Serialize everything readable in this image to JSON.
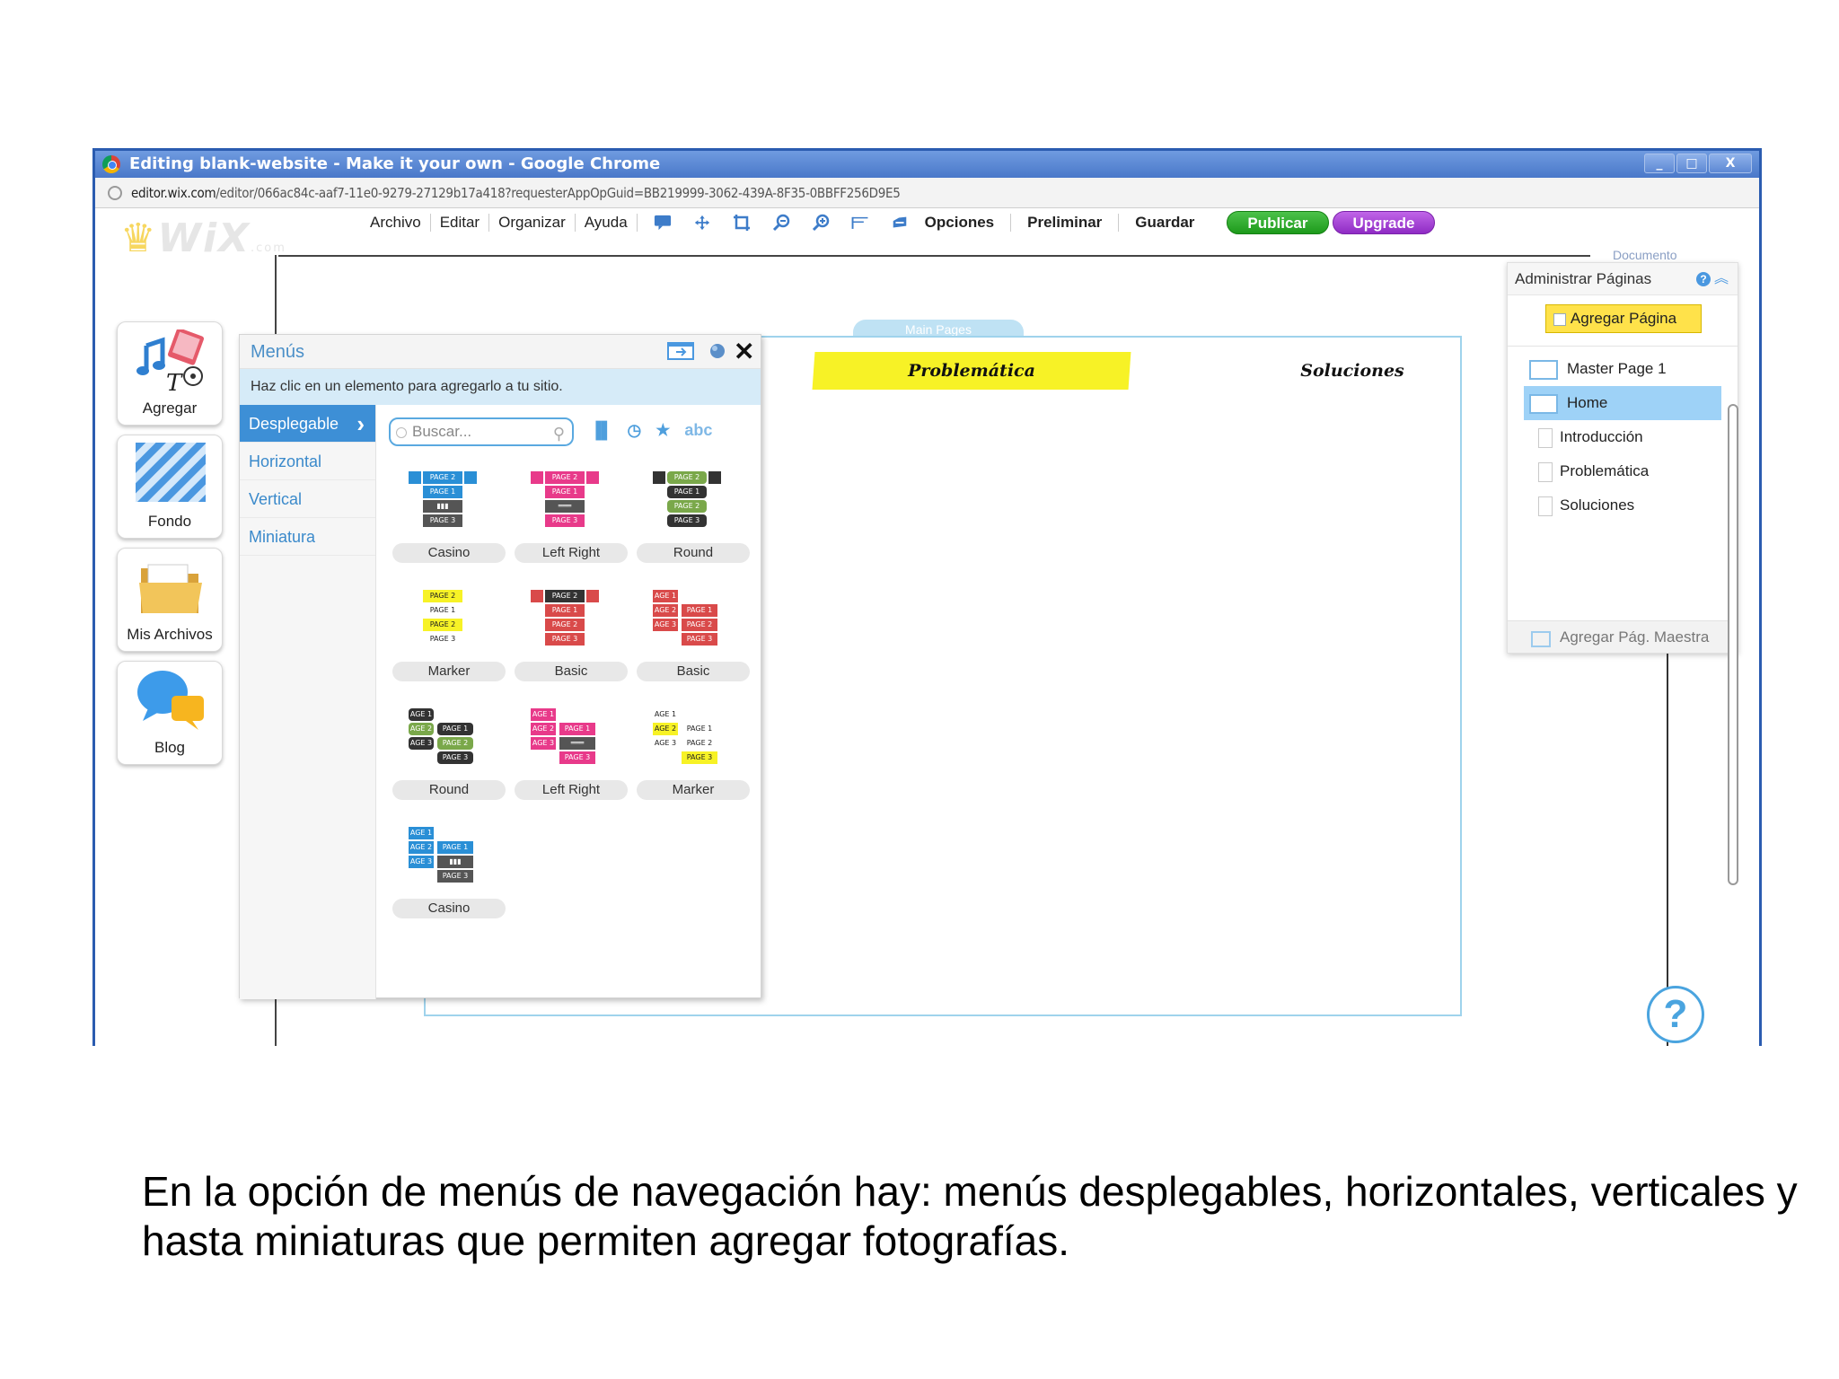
{
  "window": {
    "title": "Editing blank-website - Make it your own - Google Chrome",
    "controls": [
      "_",
      "□",
      "X"
    ],
    "url_host": "editor.wix.com",
    "url_path": "/editor/066ac84c-aaf7-11e0-9279-27129b17a418?requesterAppOpGuid=BB219999-3062-439A-8F35-0BBFF256D9E5"
  },
  "editor": {
    "logo": "WiX",
    "logo_suffix": ".com",
    "menu": [
      "Archivo",
      "Editar",
      "Organizar",
      "Ayuda"
    ],
    "tools": [
      "comment-icon",
      "move-icon",
      "crop-icon",
      "zoom-out-icon",
      "zoom-in-icon",
      "flag-icon",
      "cloud-icon"
    ],
    "opciones": "Opciones",
    "preliminar": "Preliminar",
    "guardar": "Guardar",
    "publicar": "Publicar",
    "upgrade": "Upgrade",
    "colors": {
      "publish": "#1d9a1b",
      "upgrade": "#8f2bc4",
      "accent": "#3d8fd6",
      "nav_highlight": "#f7f226"
    }
  },
  "sidebar": {
    "items": [
      {
        "label": "Agregar",
        "icon": "add-media-icon"
      },
      {
        "label": "Fondo",
        "icon": "background-icon"
      },
      {
        "label": "Mis Archivos",
        "icon": "folder-icon"
      },
      {
        "label": "Blog",
        "icon": "blog-bubble-icon"
      }
    ]
  },
  "stage": {
    "tab": "Main Pages",
    "nav": [
      "Problemática",
      "Soluciones"
    ]
  },
  "menus_panel": {
    "title": "Menús",
    "hint": "Haz clic en un elemento para agregarlo a tu sitio.",
    "categories": [
      "Desplegable",
      "Horizontal",
      "Vertical",
      "Miniatura"
    ],
    "active_category": "Desplegable",
    "search_placeholder": "Buscar...",
    "filter_text": "abc",
    "items": [
      {
        "name": "Casino",
        "style": "casino"
      },
      {
        "name": "Left Right",
        "style": "leftright"
      },
      {
        "name": "Round",
        "style": "round"
      },
      {
        "name": "Marker",
        "style": "marker"
      },
      {
        "name": "Basic",
        "style": "basic-dark"
      },
      {
        "name": "Basic",
        "style": "basic-red"
      },
      {
        "name": "Round",
        "style": "round2"
      },
      {
        "name": "Left Right",
        "style": "leftright2"
      },
      {
        "name": "Marker",
        "style": "marker2"
      },
      {
        "name": "Casino",
        "style": "casino2"
      }
    ]
  },
  "pages_panel": {
    "doc_label": "Documento",
    "title": "Administrar Páginas",
    "add_button": "Agregar Página",
    "pages": [
      {
        "label": "Master Page 1",
        "type": "master"
      },
      {
        "label": "Home",
        "type": "selected"
      },
      {
        "label": "Introducción",
        "type": "sub"
      },
      {
        "label": "Problemática",
        "type": "sub"
      },
      {
        "label": "Soluciones",
        "type": "sub"
      }
    ],
    "add_master": "Agregar Pág. Maestra"
  },
  "caption": "En la opción de menús de navegación hay: menús desplegables, horizontales, verticales y hasta miniaturas que permiten agregar fotografías."
}
